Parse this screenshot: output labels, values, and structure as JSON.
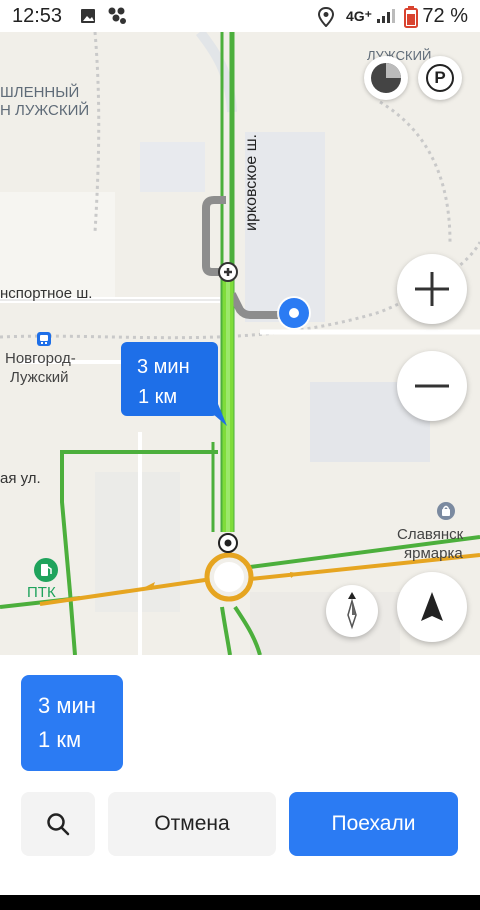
{
  "status_bar": {
    "time": "12:53",
    "network": "4G⁺",
    "battery": "72 %"
  },
  "map": {
    "labels": {
      "district_line1": "ШЛЕННЫЙ",
      "district_line2": "Н ЛУЖСКИЙ",
      "top_right": "ЛУЖСКИЙ",
      "street_transport": "нспортное ш.",
      "station_line1": "Новгород-",
      "station_line2": "Лужский",
      "street_left": "ая ул.",
      "street_vertical": "ирковское ш.",
      "market_line1": "Славянск",
      "market_line2": "ярмарка",
      "poi_ptk": "ПТК"
    },
    "route_bubble": {
      "time": "3 мин",
      "distance": "1 км"
    },
    "controls": {
      "zoom_in": "+",
      "zoom_out": "−",
      "parking": "P"
    }
  },
  "panel": {
    "route_summary": {
      "time": "3 мин",
      "distance": "1 км"
    },
    "cancel_label": "Отмена",
    "go_label": "Поехали"
  },
  "colors": {
    "route_main": "#7fdc3a",
    "road_green": "#4caf3c",
    "road_orange": "#e6a521",
    "accent_blue": "#2b7bf3"
  }
}
